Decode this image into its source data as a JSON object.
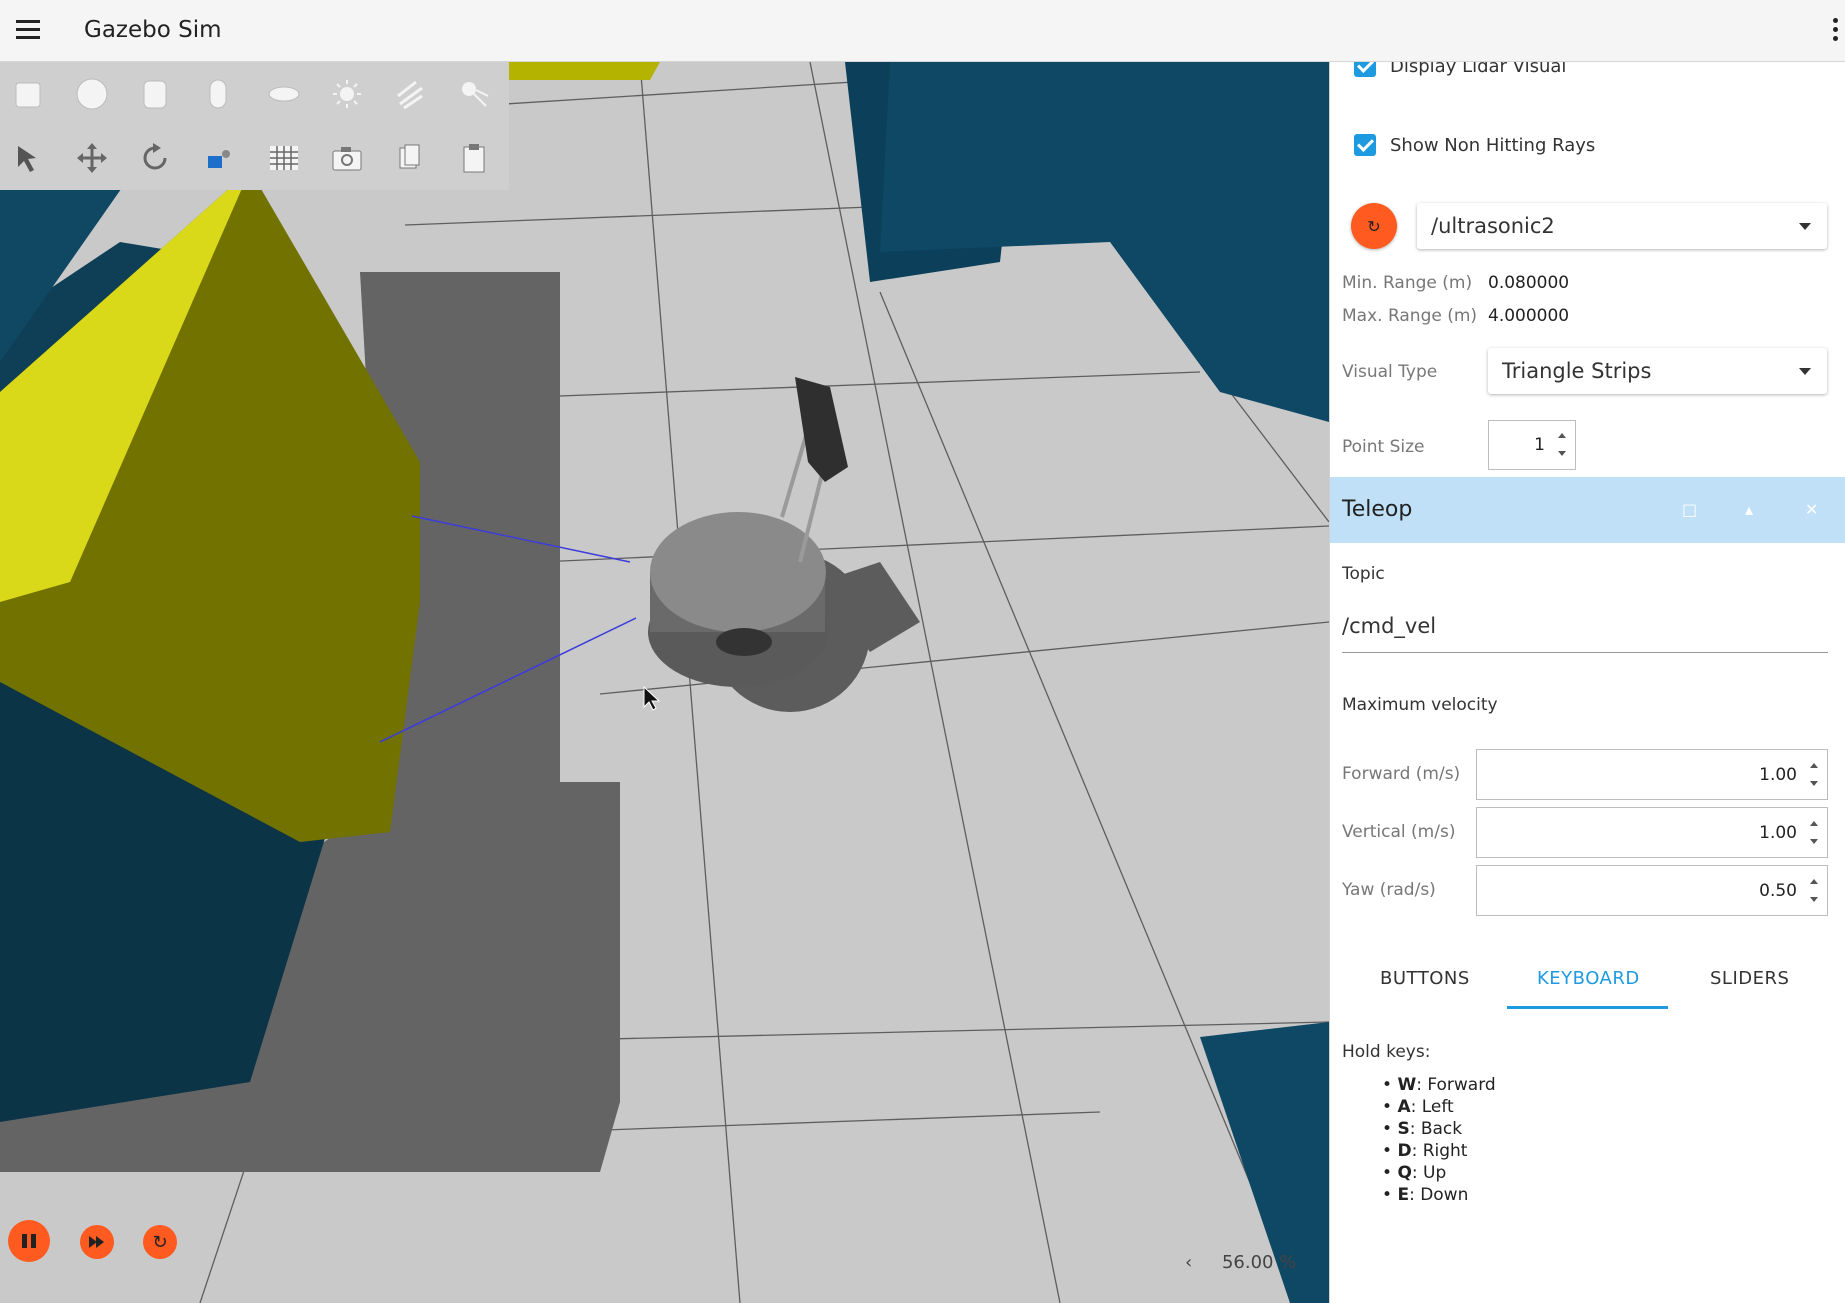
{
  "app": {
    "title": "Gazebo Sim"
  },
  "viewport": {
    "zoom": "56.00 %"
  },
  "toolbar": {
    "row1": [
      "box-shape",
      "sphere-shape",
      "cylinder-shape",
      "capsule-shape",
      "ellipsoid-shape",
      "sun-light",
      "directional-light",
      "spot-light"
    ],
    "row2": [
      "select-tool",
      "translate-tool",
      "rotate-tool",
      "transform-control",
      "grid-snap",
      "screenshot",
      "copy",
      "paste"
    ]
  },
  "lidar": {
    "display_visual_label": "Display Lidar Visual",
    "show_non_hitting_label": "Show Non Hitting Rays",
    "topic": "/ultrasonic2",
    "min_range_label": "Min. Range (m)",
    "min_range_value": "0.080000",
    "max_range_label": "Max. Range (m)",
    "max_range_value": "4.000000",
    "visual_type_label": "Visual Type",
    "visual_type_value": "Triangle Strips",
    "point_size_label": "Point Size",
    "point_size_value": "1"
  },
  "teleop": {
    "title": "Teleop",
    "topic_label": "Topic",
    "topic_value": "/cmd_vel",
    "max_velocity_label": "Maximum velocity",
    "forward_label": "Forward (m/s)",
    "forward_value": "1.00",
    "vertical_label": "Vertical (m/s)",
    "vertical_value": "1.00",
    "yaw_label": "Yaw (rad/s)",
    "yaw_value": "0.50",
    "tabs": [
      "BUTTONS",
      "KEYBOARD",
      "SLIDERS"
    ],
    "active_tab": "KEYBOARD",
    "hold_keys_label": "Hold keys:",
    "keys": [
      {
        "key": "W",
        "action": ": Forward"
      },
      {
        "key": "A",
        "action": ": Left"
      },
      {
        "key": "S",
        "action": ": Back"
      },
      {
        "key": "D",
        "action": ": Right"
      },
      {
        "key": "Q",
        "action": ": Up"
      },
      {
        "key": "E",
        "action": ": Down"
      }
    ]
  },
  "colors": {
    "accent": "#1e9be0",
    "play_button": "#ff5a1f",
    "header_blue": "#bfe0f7"
  }
}
